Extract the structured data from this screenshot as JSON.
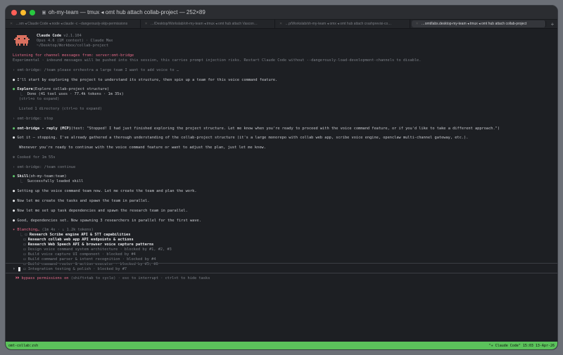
{
  "window": {
    "title": "oh-my-team — tmux ◂ omt hub attach collab-project — 252×89"
  },
  "tabs": [
    {
      "label": "…xm ◂ Claude Code ◂ node ◂ claude -c --dangerously-skip-permissions"
    },
    {
      "label": "…/Desktop/Workslab/oh-my-team ◂ tmux ◂ omt hub attach Vascon…"
    },
    {
      "label": "…p/Workslab/oh-my-team ◂ omx ◂ omt hub attach crashprevisi-co…"
    },
    {
      "label": "…omt/labs.desktop-my-team ◂ tmux ◂ omt hub attach collab-project"
    }
  ],
  "header": {
    "app_name": "Claude Code",
    "version": "v2.1.104",
    "model": "Opus 4.6 (1M context) · Claude Max",
    "cwd": "~/Desktop/Workbox/collab-project"
  },
  "notice": {
    "listening": "Listening for channel messages from: server:omt-bridge",
    "experimental": "Experimental · inbound messages will be pushed into this session, this carries prompt injection risks. Restart Claude Code without --dangerously-load-development-channels to disable."
  },
  "transcript": {
    "user1": "omt-bridge: /team please orchestra a large team I want to add voice to …",
    "msg1": "I'll start by exploring the project to understand its structure, then spin up a team for this voice command feature.",
    "explore_title": "Explore",
    "explore_args": "(Explore collab-project structure)",
    "explore_done": "Done (41 tool uses · 77.4k tokens · 1m 35s)",
    "explore_expand": "(ctrl+o to expand)",
    "listed": "Listed 1 directory (ctrl+o to expand)",
    "user2": "omt-bridge: stop",
    "reply_label": "omt-bridge - reply (MCP)",
    "reply_text": "(text: \"Stopped! I had just finished exploring the project structure. Let me know when you're ready to proceed with the voice command feature, or if you'd like to take a different approach.\")",
    "msg2": "Got it — stopping. I've already gathered a thorough understanding of the collab-project structure (it's a large monorepo with collab web app, scribe voice engine, openclaw multi-channel gateway, etc.).",
    "msg2b": "Whenever you're ready to continue with the voice command feature or want to adjust the plan, just let me know.",
    "cooked": "Cooked for 1m 55s",
    "user3": "omt-bridge: /team continue",
    "skill_title": "Skill",
    "skill_args": "(oh-my-team:team)",
    "skill_done": "Successfully loaded skill",
    "msg3": "Setting up the voice command team now. Let me create the team and plan the work.",
    "msg4": "Now let me create the tasks and spawn the team in parallel.",
    "msg5": "Now let me set up task dependencies and spawn the research team in parallel.",
    "msg6": "Good, dependencies set. Now spawning 3 researchers in parallel for the first wave.",
    "blanching": "Blanching…",
    "blanching_meta": "(1m 4s · ↓ 1.2k tokens)"
  },
  "tasks": [
    {
      "label": "Research Scribe engine API & STT capabilities",
      "active": true
    },
    {
      "label": "Research collab web app API endpoints & actions",
      "active": true
    },
    {
      "label": "Research Web Speech API & browser voice capture patterns",
      "active": true
    },
    {
      "label": "Design voice command system architecture · blocked by #1, #2, #3",
      "active": false
    },
    {
      "label": "Build voice capture UI component · blocked by #4",
      "active": false
    },
    {
      "label": "Build command parser & intent recognition · blocked by #4",
      "active": false
    },
    {
      "label": "Build command router & action executor · blocked by #5, #6",
      "active": false
    },
    {
      "label": "Integration testing & polish · blocked by #7",
      "active": false
    }
  ],
  "prompt": {
    "symbol": "›"
  },
  "status": {
    "mode": "⏵⏵ bypass permissions on",
    "hints": "(shift+tab to cycle) · esc to interrupt · ctrl+t to hide tasks"
  },
  "tmux": {
    "left": "omt-collab:zsh",
    "right": "\"✳ Claude Code\" 15:03 13-Apr-26"
  },
  "colors": {
    "accent": "#ea6a8a",
    "tmux_bar": "#5bc25b",
    "logo": "#d9705f"
  }
}
